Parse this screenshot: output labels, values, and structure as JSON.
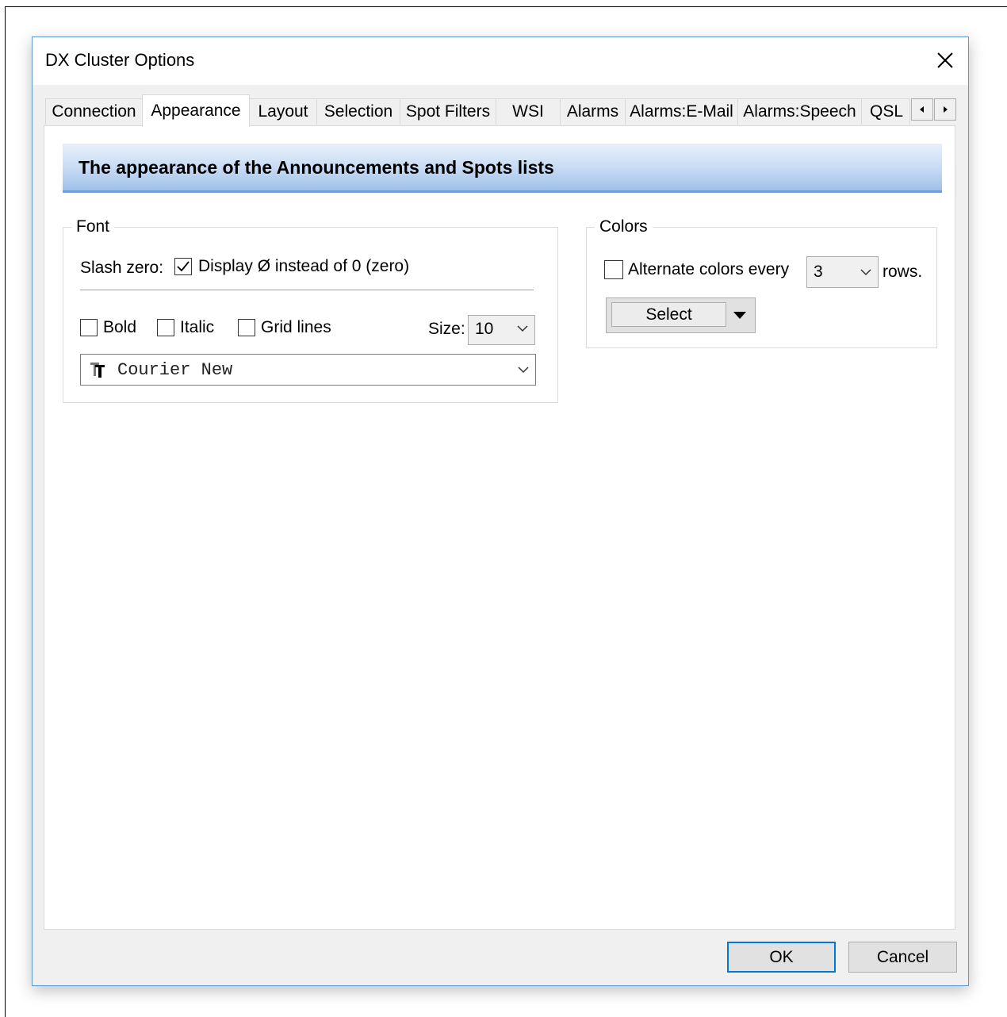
{
  "window": {
    "title": "DX Cluster Options"
  },
  "tabs": [
    {
      "label": "Connection"
    },
    {
      "label": "Appearance"
    },
    {
      "label": "Layout"
    },
    {
      "label": "Selection"
    },
    {
      "label": "Spot Filters"
    },
    {
      "label": "WSI"
    },
    {
      "label": "Alarms"
    },
    {
      "label": "Alarms:E-Mail"
    },
    {
      "label": "Alarms:Speech"
    },
    {
      "label": "QSL"
    }
  ],
  "active_tab": "Appearance",
  "banner": {
    "text": "The appearance of the Announcements and Spots lists"
  },
  "font_group": {
    "legend": "Font",
    "slash_zero_label": "Slash zero:",
    "slash_zero_checkbox": {
      "label": "Display Ø instead of 0 (zero)",
      "checked": true
    },
    "bold": {
      "label": "Bold",
      "checked": false
    },
    "italic": {
      "label": "Italic",
      "checked": false
    },
    "grid_lines": {
      "label": "Grid lines",
      "checked": false
    },
    "size_label": "Size:",
    "size_value": "10",
    "font_name": "Courier New"
  },
  "colors_group": {
    "legend": "Colors",
    "alternate": {
      "label": "Alternate colors every",
      "checked": false
    },
    "rows_value": "3",
    "rows_suffix": "rows.",
    "select_button": "Select"
  },
  "buttons": {
    "ok": "OK",
    "cancel": "Cancel"
  },
  "colors": {
    "accent": "#0078d7",
    "banner_top": "#e8f0fb",
    "banner_bottom": "#9fc0ea",
    "dialog_border": "#5b9bd5"
  }
}
